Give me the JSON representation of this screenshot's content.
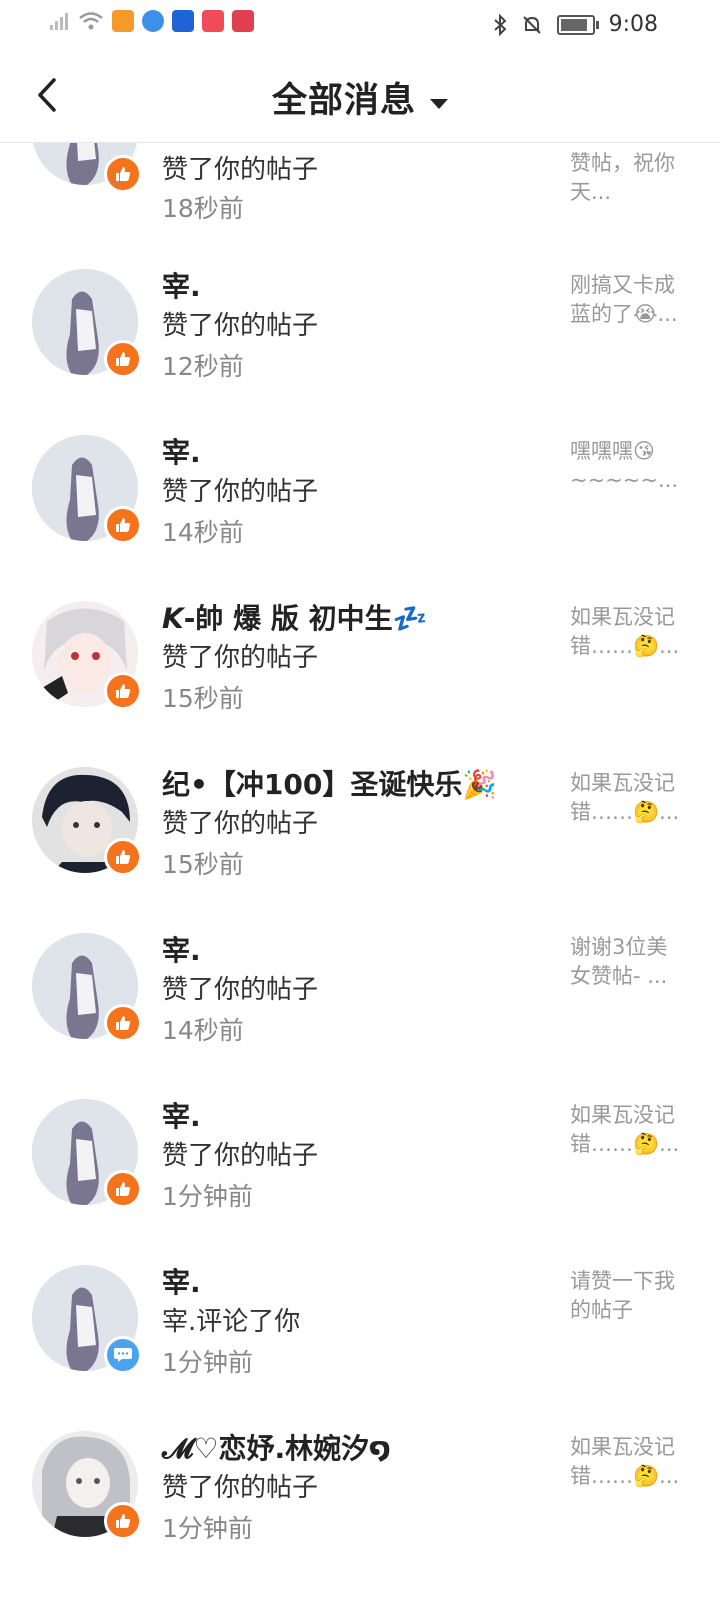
{
  "status_bar": {
    "time": "9:08",
    "icons": [
      "signal-icon",
      "wifi-icon",
      "video-app-icon",
      "browser-app-icon",
      "bulb-app-icon",
      "mail-app-icon",
      "book-app-icon",
      "bluetooth-icon",
      "mute-icon",
      "battery-icon"
    ]
  },
  "header": {
    "title": "全部消息"
  },
  "colors": {
    "like_badge": "#f5731c",
    "comment_badge": "#4aa3f0"
  },
  "messages": [
    {
      "name": "",
      "action": "赞了你的帖子",
      "time": "18秒前",
      "preview": "赞帖，祝你天...",
      "badge": "like"
    },
    {
      "name": "宰.",
      "action": "赞了你的帖子",
      "time": "12秒前",
      "preview": "刚搞又卡成蓝的了😭...",
      "badge": "like"
    },
    {
      "name": "宰.",
      "action": "赞了你的帖子",
      "time": "14秒前",
      "preview": "嘿嘿嘿😘~~~~~...",
      "badge": "like"
    },
    {
      "name": "𝙆-帥 爆 版 初中生💤",
      "action": "赞了你的帖子",
      "time": "15秒前",
      "preview": "如果瓦没记错……🤔...",
      "badge": "like"
    },
    {
      "name": "纪•【冲100】圣诞快乐🎉",
      "action": "赞了你的帖子",
      "time": "15秒前",
      "preview": "如果瓦没记错……🤔...",
      "badge": "like"
    },
    {
      "name": "宰.",
      "action": "赞了你的帖子",
      "time": "14秒前",
      "preview": "谢谢3位美女赞帖- ...",
      "badge": "like"
    },
    {
      "name": "宰.",
      "action": "赞了你的帖子",
      "time": "1分钟前",
      "preview": "如果瓦没记错……🤔...",
      "badge": "like"
    },
    {
      "name": "宰.",
      "action": "宰.评论了你",
      "time": "1分钟前",
      "preview": "请赞一下我的帖子",
      "badge": "comment"
    },
    {
      "name": "𝓜♡恋妤.林婉汐໑",
      "action": "赞了你的帖子",
      "time": "1分钟前",
      "preview": "如果瓦没记错……🤔...",
      "badge": "like"
    }
  ]
}
